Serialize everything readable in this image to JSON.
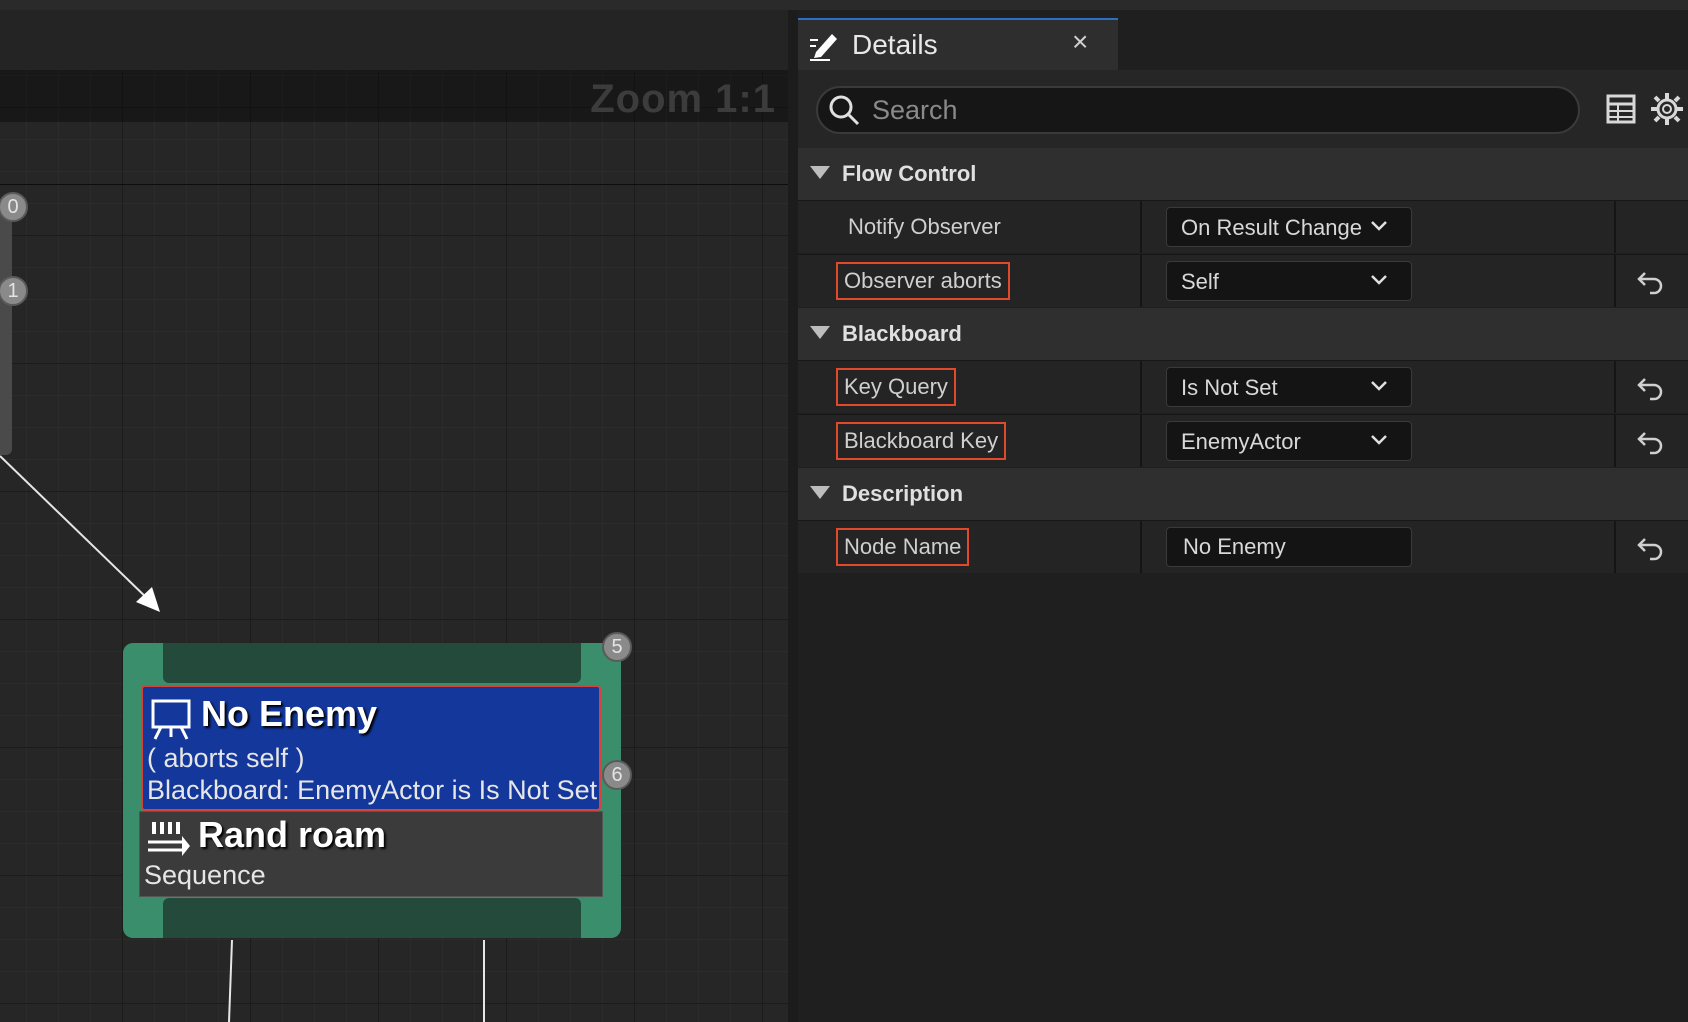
{
  "graph": {
    "zoom_label": "Zoom 1:1",
    "pins": [
      "0",
      "1",
      "5",
      "6"
    ],
    "decorator": {
      "title": "No Enemy",
      "line1": "( aborts self )",
      "line2": "Blackboard: EnemyActor is Is Not Set",
      "icon": "blackboard-icon"
    },
    "task": {
      "title": "Rand roam",
      "subtitle": "Sequence",
      "icon": "sequence-icon"
    }
  },
  "details": {
    "tab_title": "Details",
    "tab_close": "×",
    "search_placeholder": "Search",
    "categories": [
      {
        "title": "Flow Control"
      },
      {
        "title": "Blackboard"
      },
      {
        "title": "Description"
      }
    ],
    "rows": [
      {
        "label": "Notify Observer",
        "value": "On Result Change"
      },
      {
        "label": "Observer aborts",
        "value": "Self"
      },
      {
        "label": "Key Query",
        "value": "Is Not Set"
      },
      {
        "label": "Blackboard Key",
        "value": "EnemyActor"
      },
      {
        "label": "Node Name",
        "value": "No Enemy"
      }
    ]
  },
  "colors": {
    "highlight": "#e04a2a",
    "node_green": "#3a8e6c",
    "decorator_blue": "#13379a",
    "tab_accent": "#2d6fc4"
  }
}
